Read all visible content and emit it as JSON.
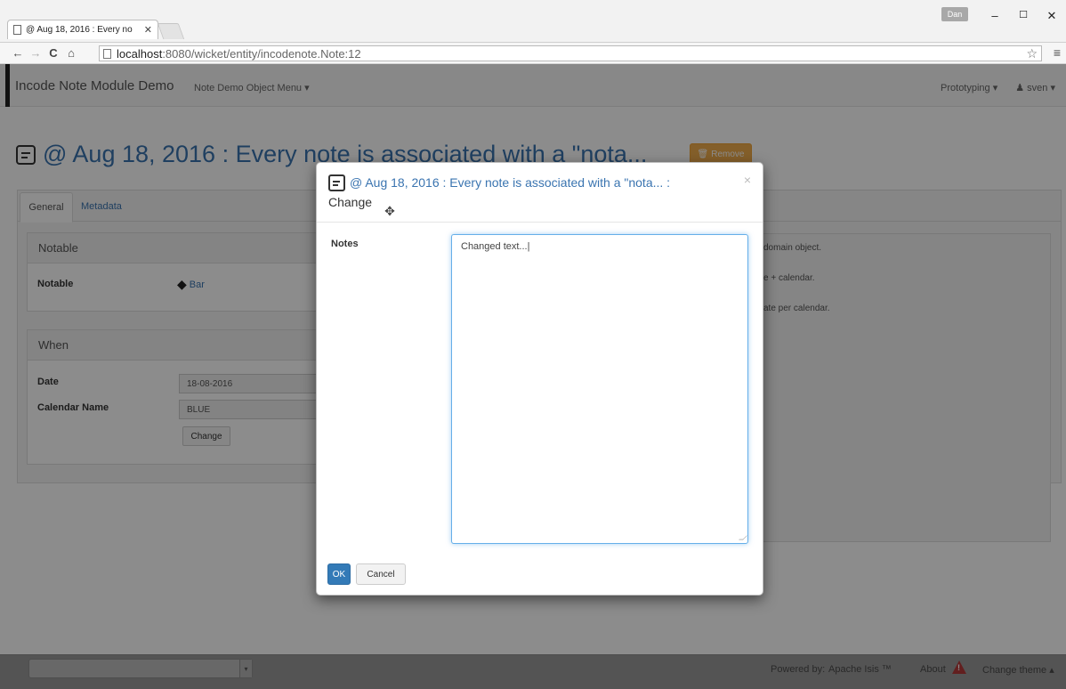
{
  "browser": {
    "tab_title": "@ Aug 18, 2016 : Every no",
    "tab_close": "✕",
    "user_chip": "Dan",
    "url_host": "localhost",
    "url_path": ":8080/wicket/entity/incodenote.Note:12",
    "controls": {
      "minimize": "–",
      "maximize": "☐",
      "close": "✕"
    }
  },
  "navbar": {
    "brand": "Incode Note Module Demo",
    "menu": "Note Demo Object Menu ▾",
    "prototyping": "Prototyping ▾",
    "user": "sven ▾"
  },
  "page": {
    "title": "@ Aug 18, 2016 : Every note is associated with a \"nota...",
    "remove_button": "Remove",
    "tabs": {
      "general": "General",
      "metadata": "Metadata"
    },
    "notable_panel": {
      "heading": "Notable",
      "label": "Notable",
      "value": "Bar"
    },
    "when_panel": {
      "heading": "When",
      "date_label": "Date",
      "date_value": "18-08-2016",
      "calendar_label": "Calendar Name",
      "calendar_value": "BLUE",
      "change_button": "Change"
    },
    "notes_preview": [
      "domain object.",
      "e + calendar.",
      "ate per calendar."
    ]
  },
  "dialog": {
    "title": "@ Aug 18, 2016 : Every note is associated with a \"nota... :",
    "subtitle": "Change",
    "close": "×",
    "notes_label": "Notes",
    "notes_value": "Changed text...|",
    "ok_button": "OK",
    "cancel_button": "Cancel"
  },
  "footer": {
    "powered_by": "Powered by:",
    "apache_isis": "Apache Isis ™",
    "about": "About",
    "change_theme": "Change theme ▴"
  }
}
